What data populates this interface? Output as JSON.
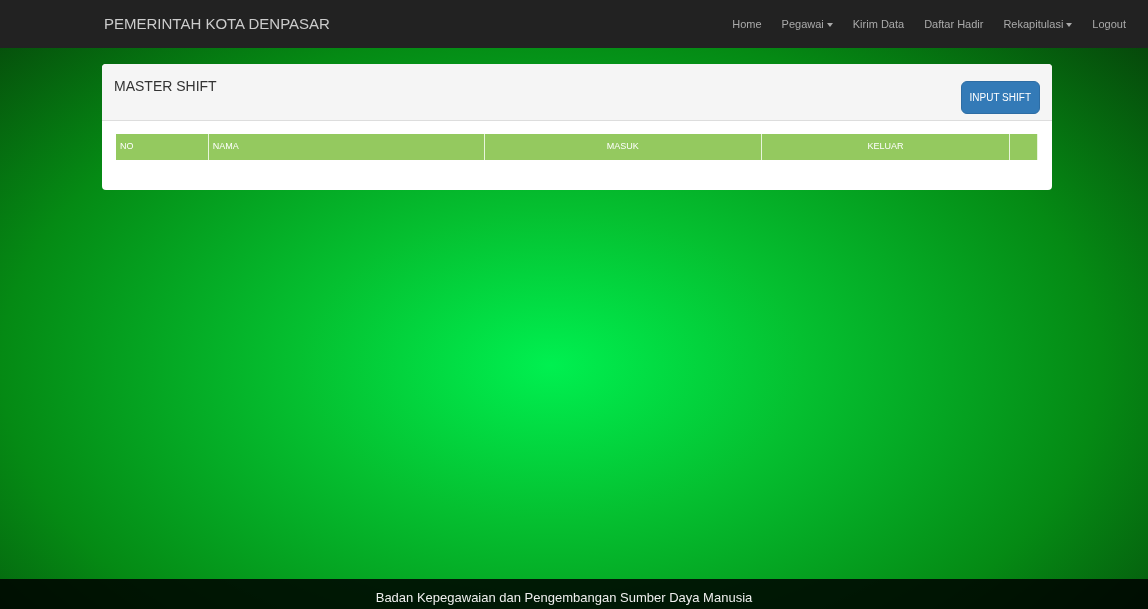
{
  "navbar": {
    "brand": "PEMERINTAH KOTA DENPASAR",
    "items": [
      {
        "label": "Home",
        "dropdown": false
      },
      {
        "label": "Pegawai",
        "dropdown": true
      },
      {
        "label": "Kirim Data",
        "dropdown": false
      },
      {
        "label": "Daftar Hadir",
        "dropdown": false
      },
      {
        "label": "Rekapitulasi",
        "dropdown": true
      },
      {
        "label": "Logout",
        "dropdown": false
      }
    ]
  },
  "panel": {
    "title": "MASTER SHIFT",
    "button": "INPUT SHIFT",
    "table": {
      "columns": [
        "NO",
        "NAMA",
        "MASUK",
        "KELUAR"
      ]
    }
  },
  "footer": "Badan Kepegawaian dan Pengembangan Sumber Daya Manusia"
}
